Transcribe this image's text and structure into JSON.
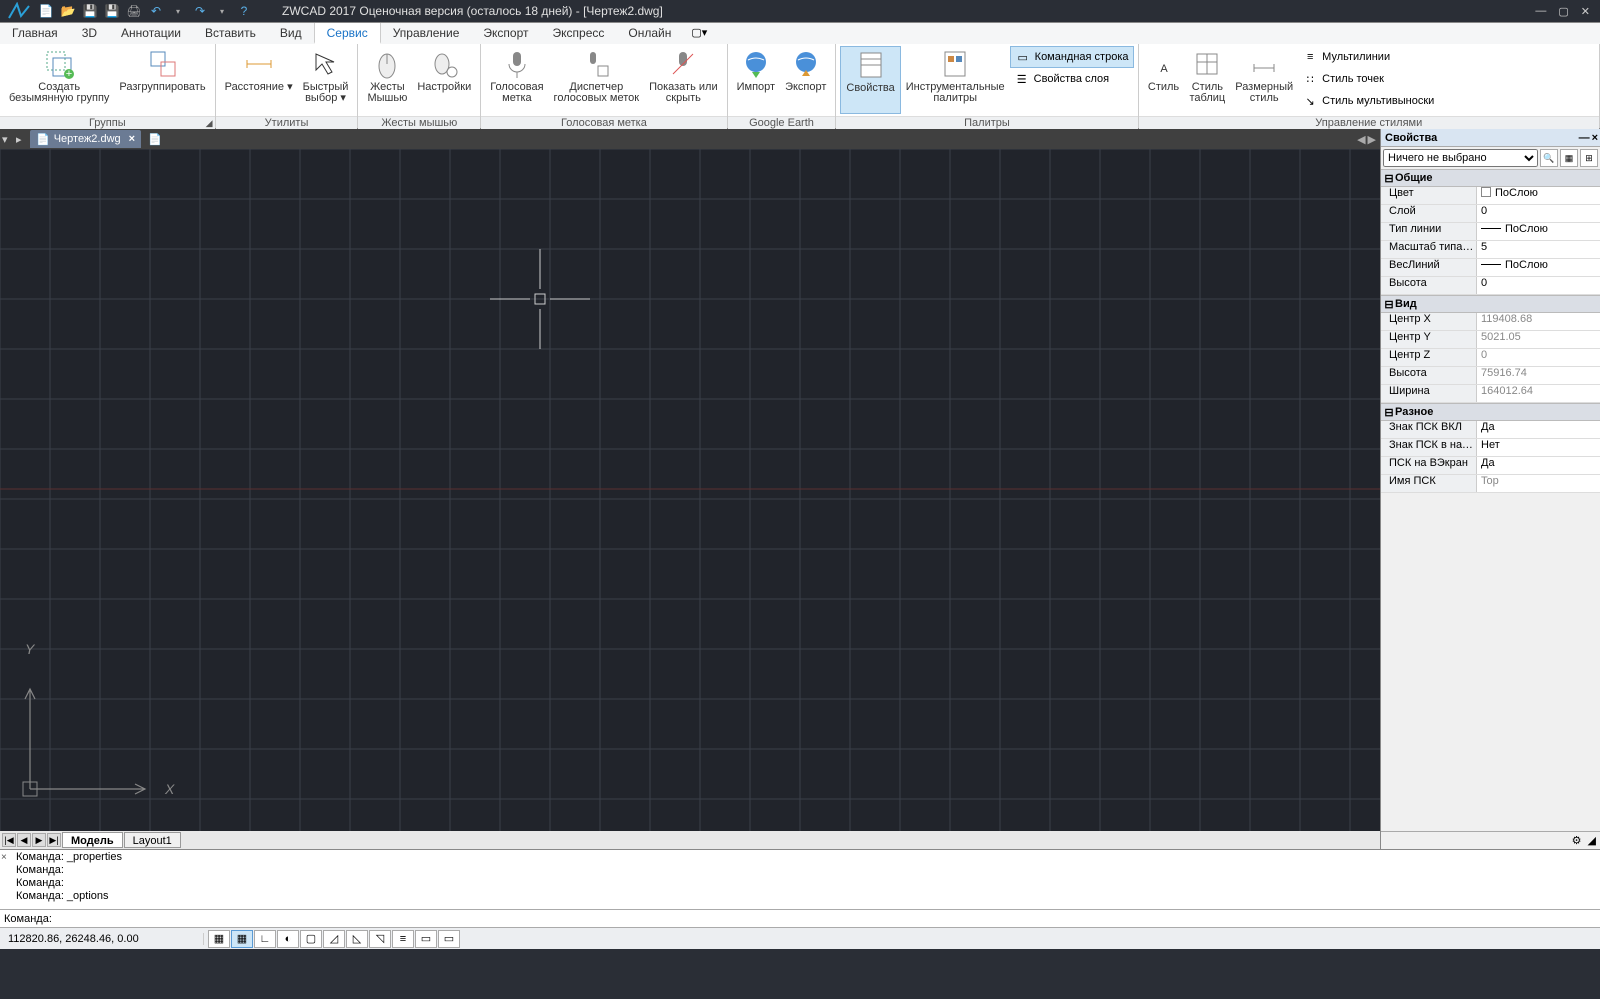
{
  "titlebar": {
    "title": "ZWCAD 2017 Оценочная версия (осталось 18 дней) - [Чертеж2.dwg]",
    "qat_icons": [
      "new-icon",
      "open-icon",
      "save-icon",
      "saveas-icon",
      "print-icon",
      "undo-icon",
      "redo-icon",
      "help-icon"
    ]
  },
  "ribbon": {
    "tabs": [
      "Главная",
      "3D",
      "Аннотации",
      "Вставить",
      "Вид",
      "Сервис",
      "Управление",
      "Экспорт",
      "Экспресс",
      "Онлайн"
    ],
    "active_tab_index": 5,
    "panels": [
      {
        "name": "groups",
        "label": "Группы",
        "buttons": [
          {
            "id": "create-unnamed-group",
            "label": "Создать\nбезымянную группу"
          },
          {
            "id": "ungroup",
            "label": "Разгруппировать"
          }
        ]
      },
      {
        "name": "utilities",
        "label": "Утилиты",
        "buttons": [
          {
            "id": "distance",
            "label": "Расстояние ▾"
          },
          {
            "id": "quick-select",
            "label": "Быстрый\nвыбор ▾"
          }
        ]
      },
      {
        "name": "mouse-gestures",
        "label": "Жесты мышью",
        "buttons": [
          {
            "id": "mouse-gestures",
            "label": "Жесты\nМышью"
          },
          {
            "id": "settings",
            "label": "Настройки"
          }
        ]
      },
      {
        "name": "voice-label",
        "label": "Голосовая метка",
        "buttons": [
          {
            "id": "voice-label",
            "label": "Голосовая\nметка"
          },
          {
            "id": "voice-manager",
            "label": "Диспетчер\nголосовых меток"
          },
          {
            "id": "show-hide",
            "label": "Показать или\nскрыть"
          }
        ]
      },
      {
        "name": "google-earth",
        "label": "Google Earth",
        "buttons": [
          {
            "id": "import",
            "label": "Импорт"
          },
          {
            "id": "export",
            "label": "Экспорт"
          }
        ]
      },
      {
        "name": "palettes",
        "label": "Палитры",
        "buttons": [
          {
            "id": "properties",
            "label": "Свойства",
            "highlighted": true
          },
          {
            "id": "tool-palettes",
            "label": "Инструментальные\nпалитры"
          }
        ],
        "small_buttons": [
          {
            "id": "command-line",
            "label": "Командная строка",
            "highlighted": true
          },
          {
            "id": "layer-properties",
            "label": "Свойства слоя"
          }
        ]
      },
      {
        "name": "style-management",
        "label": "Управление стилями",
        "buttons": [
          {
            "id": "text-style",
            "label": "Стиль"
          },
          {
            "id": "table-style",
            "label": "Стиль\nтаблиц"
          },
          {
            "id": "dim-style",
            "label": "Размерный\nстиль"
          }
        ],
        "small_buttons": [
          {
            "id": "multilines",
            "label": "Мультилинии"
          },
          {
            "id": "point-style",
            "label": "Стиль точек"
          },
          {
            "id": "multileader-style",
            "label": "Стиль мультивыноски"
          }
        ]
      }
    ]
  },
  "document_tabs": {
    "tabs": [
      {
        "name": "Чертеж2.dwg",
        "active": true
      }
    ]
  },
  "model_tabs": {
    "tabs": [
      {
        "name": "Модель",
        "active": true
      },
      {
        "name": "Layout1",
        "active": false
      }
    ]
  },
  "ucs_labels": {
    "x": "X",
    "y": "Y"
  },
  "properties_panel": {
    "title": "Свойства",
    "selector": "Ничего не выбрано",
    "groups": [
      {
        "name": "general",
        "title": "Общие",
        "rows": [
          {
            "name": "Цвет",
            "value": "ПоСлою",
            "swatch": true
          },
          {
            "name": "Слой",
            "value": "0"
          },
          {
            "name": "Тип линии",
            "value": "ПоСлою",
            "line": true
          },
          {
            "name": "Масштаб типа л...",
            "value": "5"
          },
          {
            "name": "ВесЛиний",
            "value": "ПоСлою",
            "line": true
          },
          {
            "name": "Высота",
            "value": "0"
          }
        ]
      },
      {
        "name": "view",
        "title": "Вид",
        "rows": [
          {
            "name": "Центр X",
            "value": "119408.68",
            "ro": true
          },
          {
            "name": "Центр Y",
            "value": "5021.05",
            "ro": true
          },
          {
            "name": "Центр Z",
            "value": "0",
            "ro": true
          },
          {
            "name": "Высота",
            "value": "75916.74",
            "ro": true
          },
          {
            "name": "Ширина",
            "value": "164012.64",
            "ro": true
          }
        ]
      },
      {
        "name": "misc",
        "title": "Разное",
        "rows": [
          {
            "name": "Знак ПСК ВКЛ",
            "value": "Да"
          },
          {
            "name": "Знак ПСК в нач. ...",
            "value": "Нет"
          },
          {
            "name": "ПСК на ВЭкран",
            "value": "Да"
          },
          {
            "name": "Имя ПСК",
            "value": "Top",
            "ro": true
          }
        ]
      }
    ]
  },
  "command": {
    "history": "Команда: _properties\nКоманда:\nКоманда:\nКоманда: _options",
    "prompt": "Команда: ",
    "input": ""
  },
  "statusbar": {
    "coords": "112820.86, 26248.46, 0.00"
  }
}
